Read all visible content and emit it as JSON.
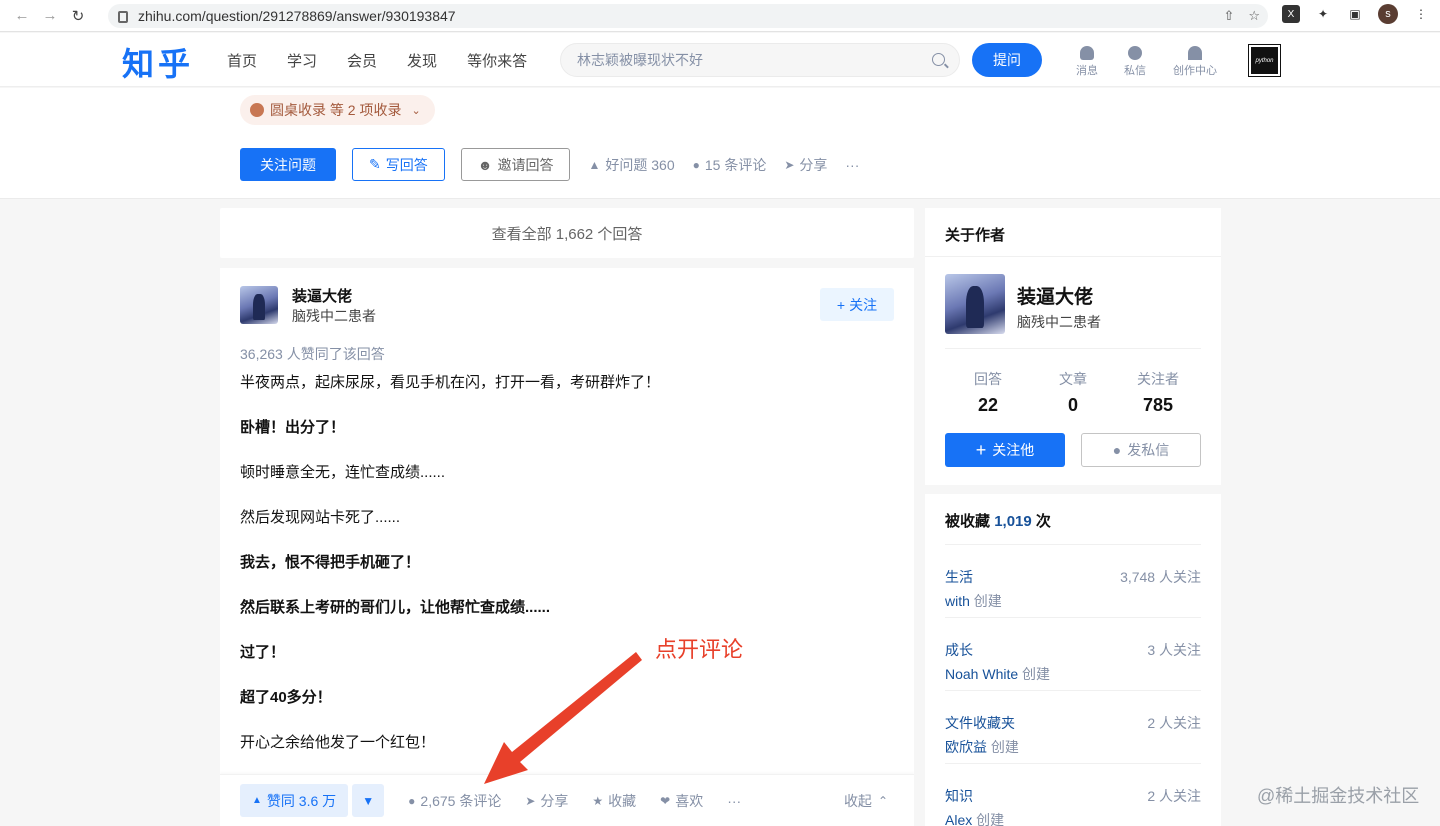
{
  "browser": {
    "url": "zhihu.com/question/291278869/answer/930193847",
    "profile_initial": "s"
  },
  "header": {
    "logo": "知乎",
    "nav": [
      "首页",
      "学习",
      "会员",
      "发现",
      "等你来答"
    ],
    "search_placeholder": "林志颖被曝现状不好",
    "ask_label": "提问",
    "icons": [
      {
        "label": "消息",
        "icon": "bell-icon"
      },
      {
        "label": "私信",
        "icon": "chat-icon"
      },
      {
        "label": "创作中心",
        "icon": "creator-icon"
      }
    ],
    "qr_text": "python"
  },
  "question": {
    "collect_tag": "圆桌收录 等 2 项收录",
    "follow_label": "关注问题",
    "write_label": "写回答",
    "invite_label": "邀请回答",
    "good_question": "好问题 360",
    "comments": "15 条评论",
    "share": "分享",
    "more": "···"
  },
  "view_all": "查看全部 1,662 个回答",
  "answer": {
    "author_name": "装逼大佬",
    "author_bio": "脑残中二患者",
    "follow_label": "关注",
    "votes_line": "36,263 人赞同了该回答",
    "paragraphs": [
      {
        "text": "半夜两点，起床尿尿，看见手机在闪，打开一看，考研群炸了！",
        "bold": false
      },
      {
        "text": "卧槽！出分了！",
        "bold": true
      },
      {
        "text": "顿时睡意全无，连忙查成绩......",
        "bold": false
      },
      {
        "text": "然后发现网站卡死了......",
        "bold": false
      },
      {
        "text": "我去，恨不得把手机砸了！",
        "bold": true
      },
      {
        "text": "然后联系上考研的哥们儿，让他帮忙查成绩......",
        "bold": true
      },
      {
        "text": "过了！",
        "bold": true
      },
      {
        "text": "超了40多分！",
        "bold": true
      },
      {
        "text": "开心之余给他发了一个红包！",
        "bold": false
      }
    ],
    "bottom": {
      "vote_up": "赞同 3.6 万",
      "comments": "2,675 条评论",
      "share": "分享",
      "collect": "收藏",
      "like": "喜欢",
      "more": "···",
      "collapse": "收起"
    }
  },
  "annotation": {
    "text": "点开评论",
    "color": "#e8402a"
  },
  "author_card": {
    "title": "关于作者",
    "name": "装逼大佬",
    "bio": "脑残中二患者",
    "stats": [
      {
        "label": "回答",
        "value": "22"
      },
      {
        "label": "文章",
        "value": "0"
      },
      {
        "label": "关注者",
        "value": "785"
      }
    ],
    "follow_label": "关注他",
    "message_label": "发私信"
  },
  "favorites": {
    "title_prefix": "被收藏",
    "count": "1,019",
    "title_suffix": "次",
    "items": [
      {
        "name": "生活",
        "creator": "with",
        "created": "创建",
        "followers": "3,748 人关注"
      },
      {
        "name": "成长",
        "creator": "Noah White",
        "created": "创建",
        "followers": "3 人关注"
      },
      {
        "name": "文件收藏夹",
        "creator": "欧欣益",
        "created": "创建",
        "followers": "2 人关注"
      },
      {
        "name": "知识",
        "creator": "Alex",
        "created": "创建",
        "followers": "2 人关注"
      }
    ]
  },
  "watermark": "@稀土掘金技术社区",
  "colors": {
    "brand": "#1772f6",
    "link": "#175199",
    "muted": "#8590a6"
  }
}
